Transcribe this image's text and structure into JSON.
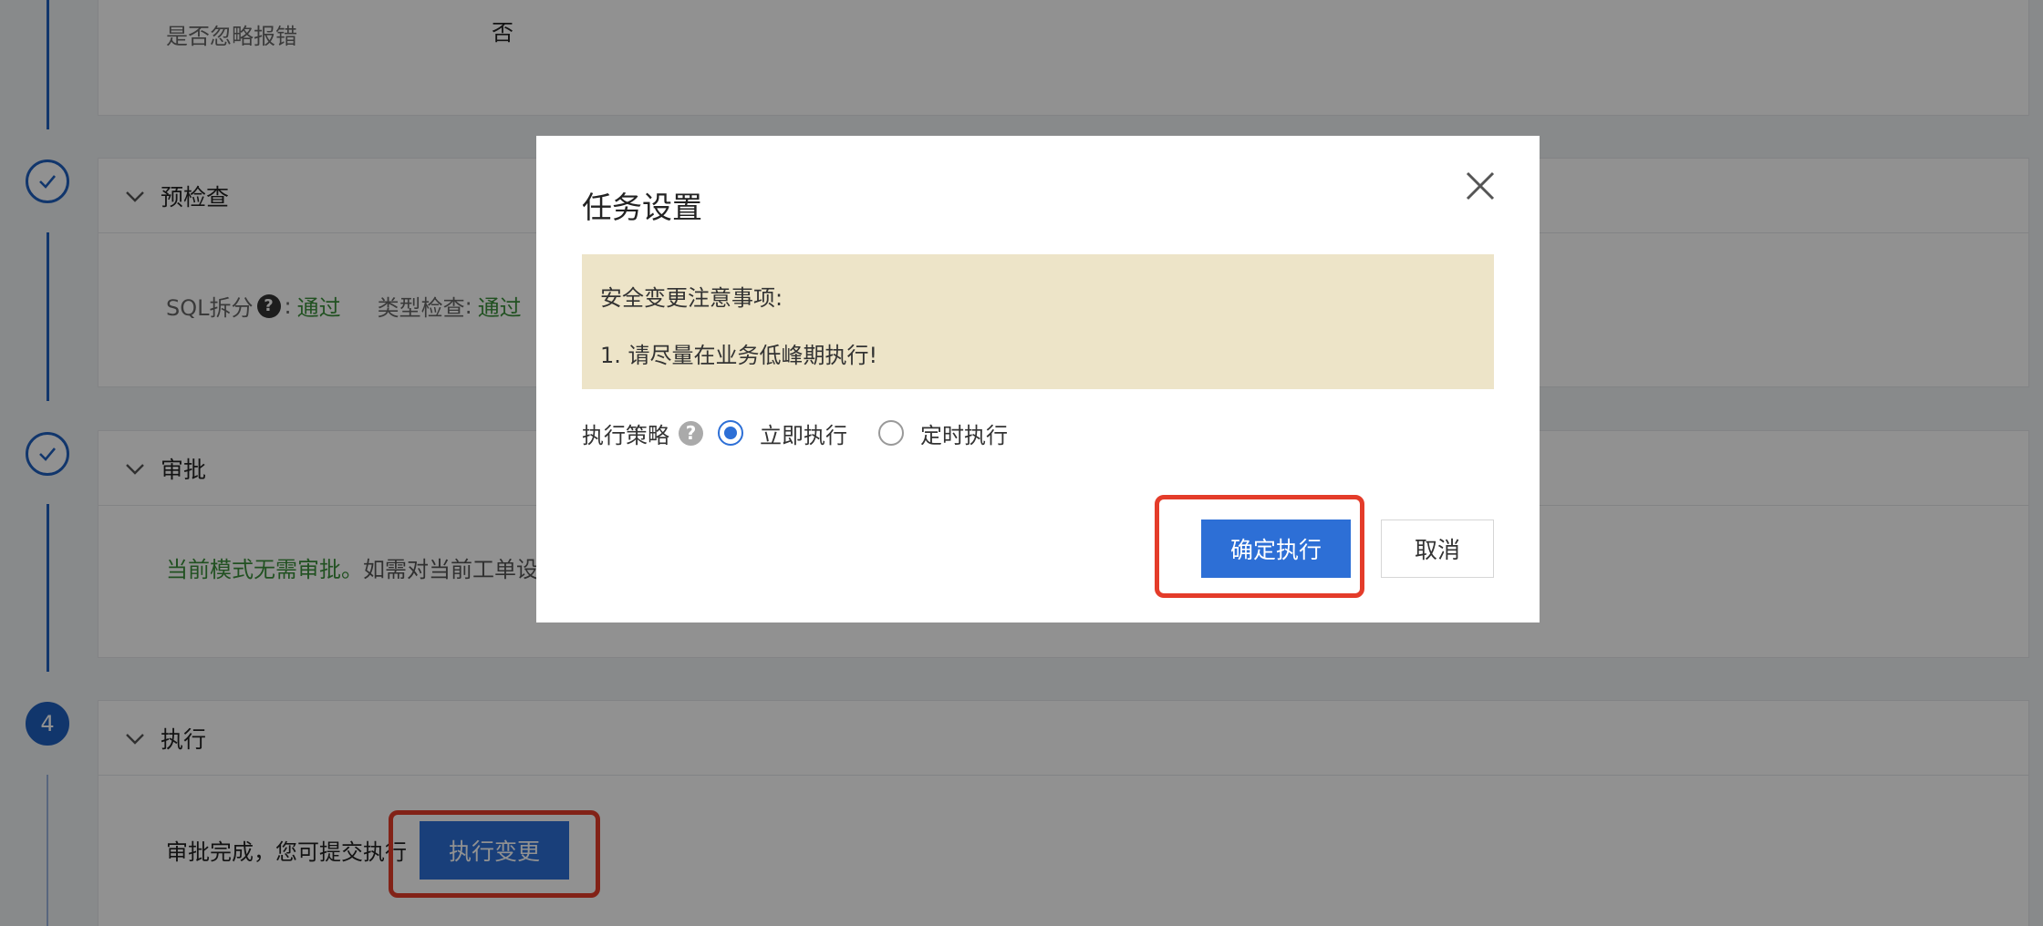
{
  "top_section": {
    "ignore_error_label": "是否忽略报错",
    "ignore_error_value": "否"
  },
  "precheck": {
    "title": "预检查",
    "sql_split_label": "SQL拆分",
    "sql_split_help": "?",
    "sql_split_colon": ":",
    "sql_split_status": "通过",
    "type_check_label": "类型检查",
    "type_check_colon": ":",
    "type_check_status": "通过"
  },
  "approval": {
    "title": "审批",
    "message_green": "当前模式无需审批。",
    "message_rest": "如需对当前工单设"
  },
  "execute": {
    "step_number": "4",
    "title": "执行",
    "message": "审批完成，您可提交执行",
    "button_label": "执行变更"
  },
  "modal": {
    "title": "任务设置",
    "notice_heading": "安全变更注意事项:",
    "notice_item_1": "1. 请尽量在业务低峰期执行!",
    "strategy_label": "执行策略",
    "strategy_help": "?",
    "options": [
      {
        "label": "立即执行",
        "checked": true
      },
      {
        "label": "定时执行",
        "checked": false
      }
    ],
    "confirm_label": "确定执行",
    "cancel_label": "取消"
  },
  "colors": {
    "primary": "#2d6fd6",
    "highlight": "#e43c2a",
    "pass": "#3a8f3a",
    "notice_bg": "#ede4c8"
  },
  "icons": {
    "step_done": "check-circle-icon",
    "collapse": "chevron-down-icon",
    "close": "close-icon",
    "help": "question-circle-icon"
  }
}
